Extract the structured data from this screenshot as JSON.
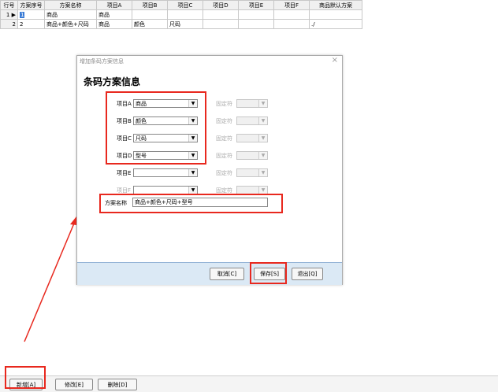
{
  "grid": {
    "headers": [
      "行号",
      "方案序号",
      "方案名称",
      "项目A",
      "项目B",
      "项目C",
      "项目D",
      "项目E",
      "项目F",
      "商品默认方案"
    ],
    "rows": [
      {
        "rownum": "1",
        "marker": "▶",
        "seq": "1",
        "name": "商品",
        "a": "商品",
        "b": "",
        "c": "",
        "d": "",
        "e": "",
        "f": "",
        "default": ""
      },
      {
        "rownum": "2",
        "marker": "",
        "seq": "2",
        "name": "商品+颜色+尺码",
        "a": "商品",
        "b": "颜色",
        "c": "尺码",
        "d": "",
        "e": "",
        "f": "",
        "default": "./"
      }
    ]
  },
  "dialog": {
    "window_title": "增加条码方案信息",
    "close_glyph": "×",
    "heading": "条码方案信息",
    "items": [
      {
        "label": "项目A",
        "value": "商品",
        "fixed_label": "固定符"
      },
      {
        "label": "项目B",
        "value": "颜色",
        "fixed_label": "固定符"
      },
      {
        "label": "项目C",
        "value": "尺码",
        "fixed_label": "固定符"
      },
      {
        "label": "项目D",
        "value": "型号",
        "fixed_label": "固定符"
      },
      {
        "label": "项目E",
        "value": "",
        "fixed_label": "固定符"
      },
      {
        "label": "项目F",
        "value": "",
        "fixed_label": "固定符"
      }
    ],
    "scheme_name_label": "方案名称",
    "scheme_name_value": "商品+颜色+尺码+型号",
    "buttons": {
      "cancel": "取消[C]",
      "save": "保存[S]",
      "exit": "退出[Q]"
    }
  },
  "toolbar": {
    "add": "新增[A]",
    "edit": "修改[E]",
    "delete": "删除[D]"
  },
  "colors": {
    "highlight": "#e8281e",
    "footer": "#dbe9f5"
  }
}
